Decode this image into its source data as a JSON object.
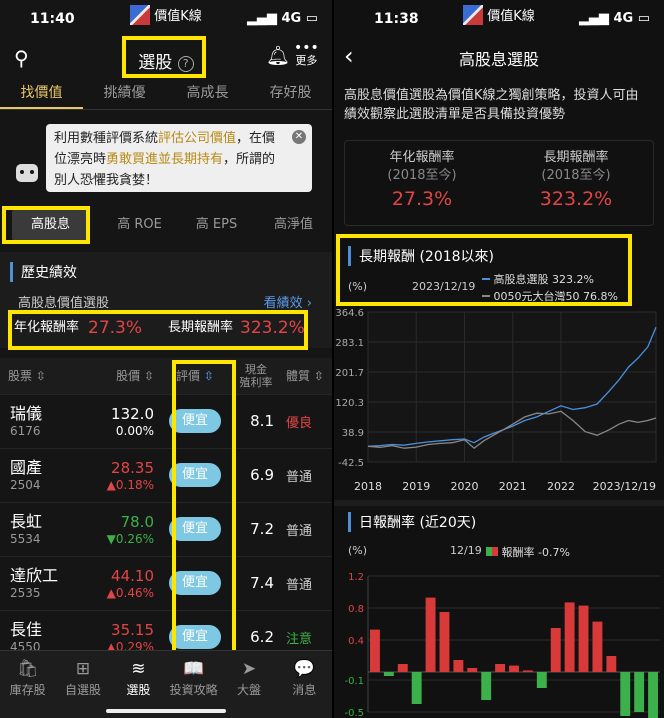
{
  "left": {
    "status": {
      "time": "11:40",
      "app_name": "價值K線",
      "network": "4G"
    },
    "nav": {
      "title": "選股",
      "more_label": "更多"
    },
    "top_tabs": [
      "找價值",
      "挑績優",
      "高成長",
      "存好股"
    ],
    "bubble": {
      "p1": "利用數種評價系統",
      "p2": "評估公司價值",
      "p3": "，在價位漂亮時",
      "p4": "勇敢買進並長期持有",
      "p5": "，所謂的別人恐懼我貪婪！"
    },
    "sub_tabs": [
      "高股息",
      "高 ROE",
      "高 EPS",
      "高淨值"
    ],
    "history": {
      "title": "歷史績效",
      "strategy": "高股息價值選股",
      "link": "看績效 ›",
      "annual_label": "年化報酬率",
      "annual_value": "27.3%",
      "long_label": "長期報酬率",
      "long_value": "323.2%"
    },
    "table": {
      "headers": {
        "stock": "股票",
        "price": "股價",
        "rating": "評價",
        "yield_top": "現金",
        "yield_bottom": "殖利率",
        "quality": "體質"
      },
      "rows": [
        {
          "name": "瑞儀",
          "code": "6176",
          "price": "132.0",
          "change": "0.00%",
          "dir": "flat",
          "rating": "便宜",
          "yield": "8.1",
          "quality": "優良",
          "qdir": "red"
        },
        {
          "name": "國產",
          "code": "2504",
          "price": "28.35",
          "change": "▲0.18%",
          "dir": "up",
          "rating": "便宜",
          "yield": "6.9",
          "quality": "普通",
          "qdir": "gray"
        },
        {
          "name": "長虹",
          "code": "5534",
          "price": "78.0",
          "change": "▼0.26%",
          "dir": "down",
          "rating": "便宜",
          "yield": "7.2",
          "quality": "普通",
          "qdir": "gray"
        },
        {
          "name": "達欣工",
          "code": "2535",
          "price": "44.10",
          "change": "▲0.46%",
          "dir": "up",
          "rating": "便宜",
          "yield": "7.4",
          "quality": "普通",
          "qdir": "gray"
        },
        {
          "name": "長佳",
          "code": "4550",
          "price": "35.15",
          "change": "▲0.29%",
          "dir": "up",
          "rating": "便宜",
          "yield": "6.2",
          "quality": "注意",
          "qdir": "green"
        }
      ]
    },
    "bottom_nav": [
      {
        "icon": "🛍",
        "label": "庫存股"
      },
      {
        "icon": "⊞",
        "label": "自選股"
      },
      {
        "icon": "≋",
        "label": "選股"
      },
      {
        "icon": "📖",
        "label": "投資攻略"
      },
      {
        "icon": "➤",
        "label": "大盤"
      },
      {
        "icon": "💬",
        "label": "消息"
      }
    ]
  },
  "right": {
    "status": {
      "time": "11:38",
      "app_name": "價值K線",
      "network": "4G"
    },
    "nav": {
      "title": "高股息選股"
    },
    "intro": "高股息價值選股為價值K線之獨創策略，投資人可由績效觀察此選股清單是否具備投資優勢",
    "summary": {
      "annual_label": "年化報酬率",
      "annual_sub": "(2018至今)",
      "annual_value": "27.3%",
      "long_label": "長期報酬率",
      "long_sub": "(2018至今)",
      "long_value": "323.2%"
    },
    "long_chart_title": "長期報酬 (2018以來)",
    "daily_chart_title": "日報酬率 (近20天)",
    "colors": {
      "blue_series": "#4a8fe0",
      "gray_series": "#888888",
      "bar_up": "#d83a3a",
      "bar_down": "#3cb04a"
    }
  },
  "chart_data": [
    {
      "type": "line",
      "title": "長期報酬 (2018以來)",
      "unit_label": "(%)",
      "date_label": "2023/12/19",
      "x_ticks": [
        "2018",
        "2019",
        "2020",
        "2021",
        "2022",
        "2023/12/19"
      ],
      "y_ticks": [
        "364.6",
        "283.1",
        "201.7",
        "120.3",
        "38.9",
        "-42.5"
      ],
      "ylim": [
        -42.5,
        364.6
      ],
      "series": [
        {
          "name": "高股息選股",
          "legend": "高股息選股 323.2%",
          "color": "#4a8fe0",
          "x": [
            2018.0,
            2018.25,
            2018.5,
            2018.75,
            2019.0,
            2019.25,
            2019.5,
            2019.75,
            2020.0,
            2020.2,
            2020.4,
            2020.6,
            2020.8,
            2021.0,
            2021.25,
            2021.5,
            2021.75,
            2022.0,
            2022.25,
            2022.5,
            2022.75,
            2023.0,
            2023.2,
            2023.4,
            2023.6,
            2023.8,
            2023.97
          ],
          "values": [
            0,
            2,
            5,
            3,
            8,
            12,
            15,
            18,
            20,
            10,
            25,
            35,
            45,
            55,
            70,
            80,
            95,
            110,
            100,
            105,
            115,
            150,
            180,
            215,
            240,
            270,
            323.2
          ]
        },
        {
          "name": "0050元大台灣50",
          "legend": "0050元大台灣50 76.8%",
          "color": "#888888",
          "x": [
            2018.0,
            2018.25,
            2018.5,
            2018.75,
            2019.0,
            2019.25,
            2019.5,
            2019.75,
            2020.0,
            2020.2,
            2020.4,
            2020.6,
            2020.8,
            2021.0,
            2021.25,
            2021.5,
            2021.75,
            2022.0,
            2022.25,
            2022.5,
            2022.75,
            2023.0,
            2023.2,
            2023.4,
            2023.6,
            2023.8,
            2023.97
          ],
          "values": [
            0,
            -3,
            2,
            -5,
            -2,
            5,
            8,
            10,
            18,
            -5,
            15,
            30,
            45,
            60,
            80,
            90,
            88,
            95,
            70,
            40,
            30,
            45,
            60,
            70,
            65,
            70,
            76.8
          ]
        }
      ]
    },
    {
      "type": "bar",
      "title": "日報酬率 (近20天)",
      "unit_label": "(%)",
      "date_label": "12/19",
      "legend": "報酬率 -0.7%",
      "y_ticks": [
        "1.2",
        "0.8",
        "0.4",
        "-0.1",
        "-0.5"
      ],
      "ylim": [
        -0.5,
        1.2
      ],
      "values": [
        0.53,
        -0.05,
        0.1,
        -0.4,
        0.93,
        0.75,
        0.15,
        0.05,
        -0.35,
        0.1,
        0.08,
        0.02,
        -0.2,
        0.55,
        0.87,
        0.83,
        0.63,
        0.2,
        -0.55,
        -0.5,
        -0.7
      ]
    }
  ]
}
